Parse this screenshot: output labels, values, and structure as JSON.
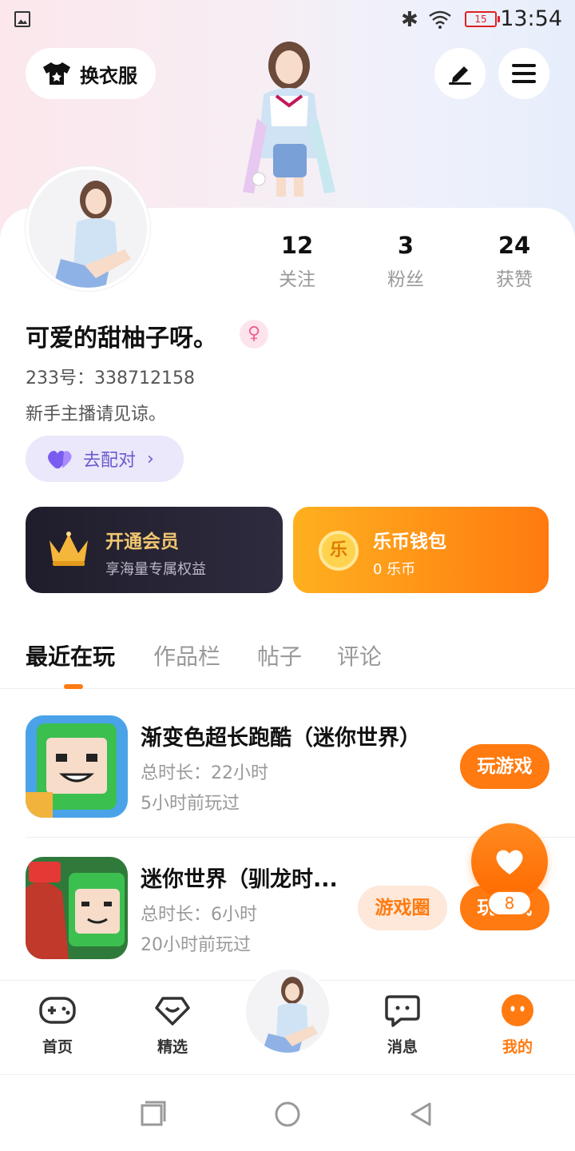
{
  "status_bar": {
    "time": "13:54",
    "battery": "15"
  },
  "header": {
    "outfit_label": "换衣服"
  },
  "profile": {
    "stats": [
      {
        "value": "12",
        "label": "关注"
      },
      {
        "value": "3",
        "label": "粉丝"
      },
      {
        "value": "24",
        "label": "获赞"
      }
    ],
    "nickname": "可爱的甜柚子呀。",
    "uid": "233号：338712158",
    "bio": "新手主播请见谅。",
    "match_label": "去配对"
  },
  "vip": {
    "title": "开通会员",
    "subtitle": "享海量专属权益"
  },
  "wallet": {
    "title": "乐币钱包",
    "subtitle": "0 乐币",
    "coin_char": "乐"
  },
  "tabs": [
    {
      "label": "最近在玩"
    },
    {
      "label": "作品栏"
    },
    {
      "label": "帖子"
    },
    {
      "label": "评论"
    }
  ],
  "games": [
    {
      "name": "渐变色超长跑酷（迷你世界）",
      "duration": "总时长：22小时",
      "last_played": "5小时前玩过",
      "play_label": "玩游戏"
    },
    {
      "name": "迷你世界（驯龙时...",
      "duration": "总时长：6小时",
      "last_played": "20小时前玩过",
      "circle_label": "游戏圈",
      "play_label": "玩游戏"
    }
  ],
  "float": {
    "count": "8"
  },
  "bottom_nav": [
    {
      "label": "首页"
    },
    {
      "label": "精选"
    },
    {
      "label": "消息"
    },
    {
      "label": "我的"
    }
  ],
  "colors": {
    "accent": "#ff7a10",
    "vip_gold": "#f1c770",
    "match_purple": "#6a5acd"
  }
}
